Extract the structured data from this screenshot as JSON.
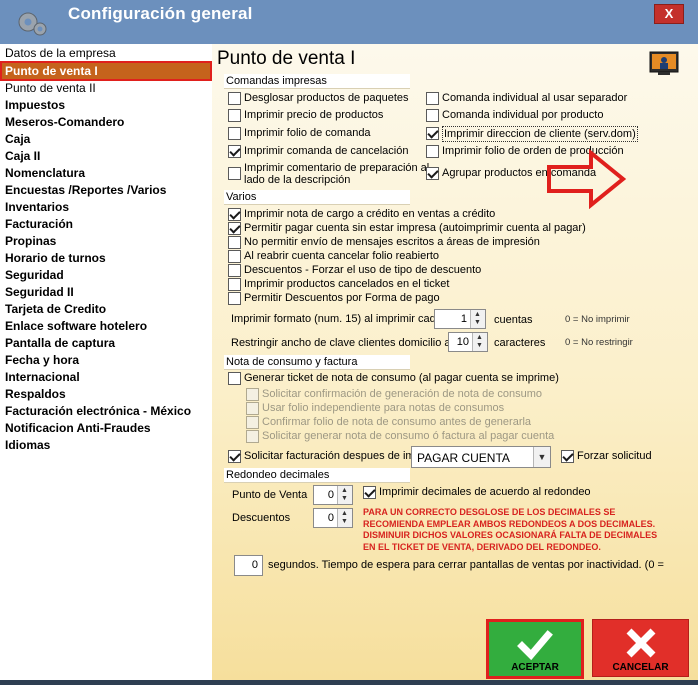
{
  "window": {
    "title": "Configuración general",
    "close_label": "X"
  },
  "sidebar": {
    "items": [
      "Datos de la empresa",
      "Punto de venta I",
      "Punto de venta II",
      "Impuestos",
      "Meseros-Comandero",
      "Caja",
      "Caja II",
      "Nomenclatura",
      "Encuestas /Reportes /Varios",
      "Inventarios",
      "Facturación",
      "Propinas",
      "Horario de turnos",
      "Seguridad",
      "Seguridad II",
      "Tarjeta de Credito",
      "Enlace software hotelero",
      "Pantalla de captura",
      "Fecha y hora",
      "Internacional",
      "Respaldos",
      "Facturación electrónica - México",
      "Notificacion Anti-Fraudes",
      "Idiomas"
    ],
    "selected": "Punto de venta I"
  },
  "main": {
    "title": "Punto de venta I",
    "groups": {
      "comandas": "Comandas impresas",
      "varios": "Varios",
      "nota": "Nota de consumo y factura",
      "redondeo": "Redondeo decimales"
    },
    "comandas_left": [
      {
        "label": "Desglosar productos de paquetes",
        "checked": false
      },
      {
        "label": "Imprimir precio de productos",
        "checked": false
      },
      {
        "label": "Imprimir folio de comanda",
        "checked": false
      },
      {
        "label": "Imprimir comanda de cancelación",
        "checked": true
      },
      {
        "label": "Imprimir comentario de preparación al",
        "label2": "lado de la descripción",
        "checked": false
      }
    ],
    "comandas_right": [
      {
        "label": "Comanda individual al usar separador",
        "checked": false
      },
      {
        "label": "Comanda individual por producto",
        "checked": false
      },
      {
        "label": "Imprimir direccion de cliente (serv.dom)",
        "checked": true
      },
      {
        "label": "Imprimir folio de orden de producción",
        "checked": false
      },
      {
        "label": "Agrupar productos en comanda",
        "checked": true
      }
    ],
    "varios_items": [
      {
        "label": "Imprimir nota de cargo a crédito en ventas a crédito",
        "checked": true
      },
      {
        "label": "Permitir pagar cuenta sin estar impresa (autoimprimir cuenta al pagar)",
        "checked": true
      },
      {
        "label": "No permitir envío de mensajes escritos a áreas de impresión",
        "checked": false
      },
      {
        "label": "Al reabrir cuenta cancelar folio reabierto",
        "checked": false
      },
      {
        "label": "Descuentos - Forzar el uso de tipo de descuento",
        "checked": false
      },
      {
        "label": "Imprimir productos cancelados en el ticket",
        "checked": false
      },
      {
        "label": "Permitir Descuentos por Forma de pago",
        "checked": false
      }
    ],
    "formato": {
      "label": "Imprimir formato (num. 15) al imprimir cada",
      "value": "1",
      "unit": "cuentas",
      "hint": "0 = No imprimir"
    },
    "ancho": {
      "label": "Restringir ancho de clave clientes domicilio a",
      "value": "10",
      "unit": "caracteres",
      "hint": "0 = No restringir"
    },
    "nota_main": {
      "label": "Generar ticket de nota de consumo (al pagar cuenta se imprime)",
      "checked": false
    },
    "nota_sub": [
      "Solicitar confirmación de generación de nota de consumo",
      "Usar folio independiente para notas de consumos",
      "Confirmar folio de nota de consumo antes de generarla",
      "Solicitar generar nota de consumo ó factura al pagar cuenta"
    ],
    "facturacion": {
      "label": "Solicitar facturación despues de imp",
      "checked": true,
      "select_value": "PAGAR CUENTA",
      "forzar_label": "Forzar solicitud",
      "forzar_checked": true
    },
    "redondeo": {
      "punto_label": "Punto de Venta",
      "punto_value": "0",
      "desc_label": "Descuentos",
      "desc_value": "0",
      "imprimir_label": "Imprimir decimales de acuerdo al redondeo",
      "imprimir_checked": true,
      "warning": [
        "PARA UN CORRECTO DESGLOSE DE LOS DECIMALES SE",
        "RECOMIENDA EMPLEAR AMBOS REDONDEOS A DOS DECIMALES.",
        "DISMINUIR DICHOS VALORES OCASIONARÁ FALTA DE DECIMALES",
        "EN EL TICKET DE VENTA, DERIVADO DEL REDONDEO."
      ]
    },
    "espera": {
      "value": "0",
      "label": "segundos. Tiempo de espera para cerrar pantallas de ventas por inactividad. (0 ="
    }
  },
  "buttons": {
    "accept": "ACEPTAR",
    "cancel": "CANCELAR"
  },
  "colors": {
    "titlebar": "#6c90bd",
    "selected": "#c5631c",
    "highlight": "#e0201d",
    "accept": "#33ad3e",
    "cancel": "#e12f29"
  }
}
